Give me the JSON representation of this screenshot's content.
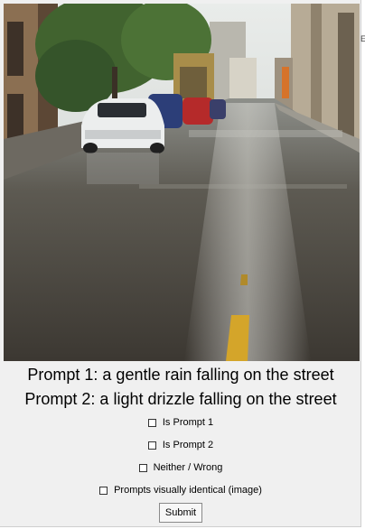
{
  "prompts": {
    "p1": "Prompt 1: a gentle rain falling on the street",
    "p2": "Prompt 2: a light drizzle falling on the street"
  },
  "options": [
    {
      "label": "Is Prompt 1",
      "checked": false
    },
    {
      "label": "Is Prompt 2",
      "checked": false
    },
    {
      "label": "Neither / Wrong",
      "checked": false
    },
    {
      "label": "Prompts visually identical (image)",
      "checked": false
    }
  ],
  "submit_label": "Submit",
  "edge_glyph": "E"
}
